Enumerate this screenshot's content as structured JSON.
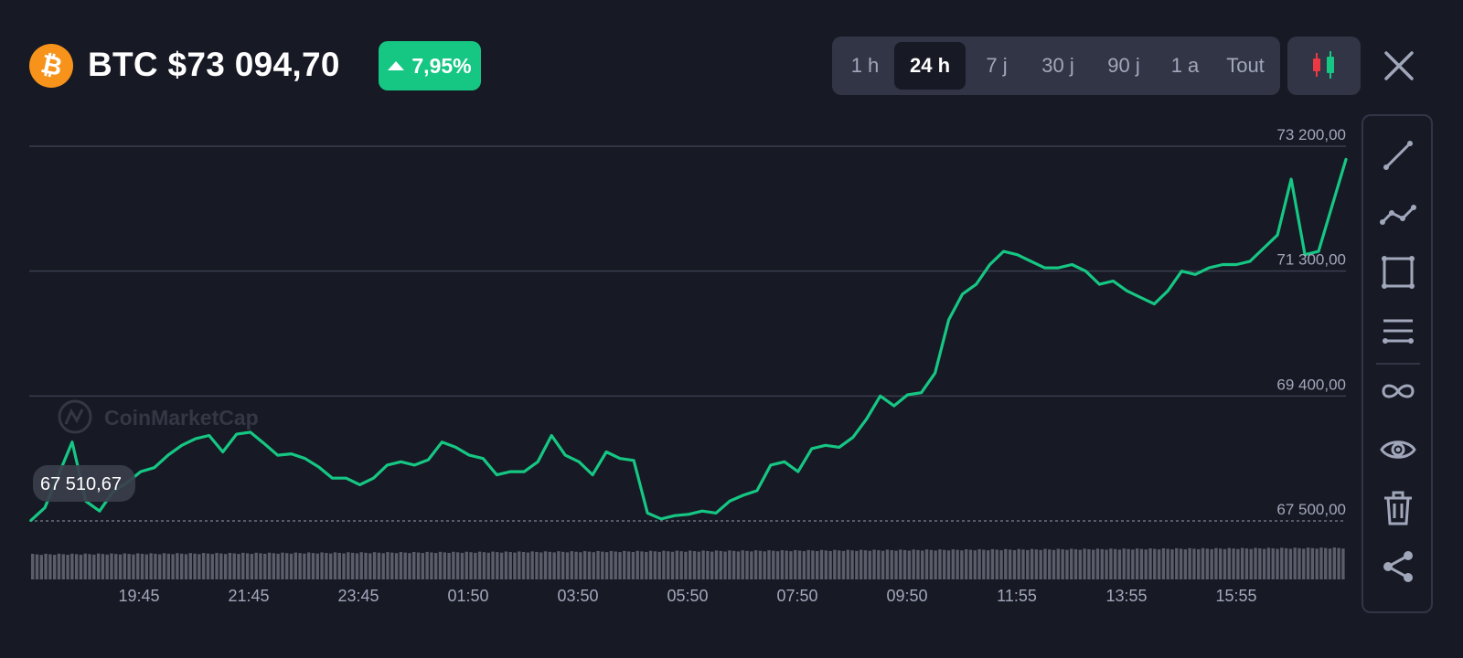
{
  "header": {
    "coin_icon": "bitcoin-icon",
    "coin_symbol_glyph": "₿",
    "title": "BTC $73 094,70",
    "change": "7,95%",
    "change_direction_icon": "triangle-up-icon"
  },
  "range_tabs": [
    {
      "label": "1 h",
      "active": false
    },
    {
      "label": "24 h",
      "active": true
    },
    {
      "label": "7 j",
      "active": false
    },
    {
      "label": "30 j",
      "active": false
    },
    {
      "label": "90 j",
      "active": false
    },
    {
      "label": "1 a",
      "active": false
    },
    {
      "label": "Tout",
      "active": false
    }
  ],
  "toolbar": {
    "chart_type_icon": "candlestick-icon",
    "close_icon": "close-icon",
    "tools": [
      "trend-line-icon",
      "polyline-icon",
      "rectangle-icon",
      "horizontal-lines-icon",
      "infinity-icon",
      "eye-icon",
      "trash-icon",
      "share-icon"
    ]
  },
  "colors": {
    "background": "#171924",
    "line": "#16c784",
    "grid": "#3a3d4d",
    "axis_text": "#a1a7bb",
    "panel": "#323546",
    "volume": "#5b5e6a",
    "candle_red": "#ea3943"
  },
  "chart_data": {
    "type": "line",
    "watermark": "CoinMarketCap",
    "x_tick_labels": [
      "19:45",
      "21:45",
      "23:45",
      "01:50",
      "03:50",
      "05:50",
      "07:50",
      "09:50",
      "11:55",
      "13:55",
      "15:55"
    ],
    "y_tick_labels": [
      "73 200,00",
      "71 300,00",
      "69 400,00",
      "67 500,00"
    ],
    "y_ticks": [
      73200,
      71300,
      69400,
      67500
    ],
    "ylim": [
      67500,
      73200
    ],
    "start_price_label": "67 510,67",
    "start_price": 67510.67,
    "grid": true,
    "x_hours": [
      0,
      0.25,
      0.5,
      0.75,
      1,
      1.25,
      1.5,
      1.75,
      2,
      2.25,
      2.5,
      2.75,
      3,
      3.25,
      3.5,
      3.75,
      4,
      4.25,
      4.5,
      4.75,
      5,
      5.25,
      5.5,
      5.75,
      6,
      6.25,
      6.5,
      6.75,
      7,
      7.25,
      7.5,
      7.75,
      8,
      8.25,
      8.5,
      8.75,
      9,
      9.25,
      9.5,
      9.75,
      10,
      10.25,
      10.5,
      10.75,
      11,
      11.25,
      11.5,
      11.75,
      12,
      12.25,
      12.5,
      12.75,
      13,
      13.25,
      13.5,
      13.75,
      14,
      14.25,
      14.5,
      14.75,
      15,
      15.25,
      15.5,
      15.75,
      16,
      16.25,
      16.5,
      16.75,
      17,
      17.25,
      17.5,
      17.75,
      18,
      18.25,
      18.5,
      18.75,
      19,
      19.25,
      19.5,
      19.75,
      20,
      20.25,
      20.5,
      20.75,
      21,
      21.25,
      21.5,
      21.75,
      22,
      22.25,
      22.5,
      22.75,
      23,
      23.25,
      23.5,
      23.75,
      24
    ],
    "series": [
      {
        "values": [
          67510,
          67700,
          68200,
          68700,
          67800,
          67650,
          67950,
          68080,
          68250,
          68310,
          68500,
          68650,
          68750,
          68800,
          68550,
          68820,
          68850,
          68680,
          68500,
          68520,
          68450,
          68320,
          68150,
          68150,
          68050,
          68150,
          68350,
          68400,
          68350,
          68430,
          68700,
          68620,
          68500,
          68450,
          68200,
          68250,
          68250,
          68400,
          68800,
          68500,
          68400,
          68200,
          68550,
          68450,
          68420,
          67620,
          67530,
          67580,
          67600,
          67650,
          67620,
          67800,
          67890,
          67960,
          68350,
          68400,
          68250,
          68600,
          68650,
          68620,
          68770,
          69050,
          69400,
          69250,
          69420,
          69450,
          69750,
          70560,
          70950,
          71100,
          71400,
          71600,
          71550,
          71450,
          71350,
          71350,
          71400,
          71300,
          71100,
          71150,
          71000,
          70900,
          70800,
          71000,
          71300,
          71250,
          71350,
          71400,
          71400,
          71450,
          71650,
          71850,
          72700,
          71550,
          71600,
          72300,
          73000,
          72700,
          73000
        ]
      }
    ],
    "volume": "bars increase slightly toward the end"
  }
}
